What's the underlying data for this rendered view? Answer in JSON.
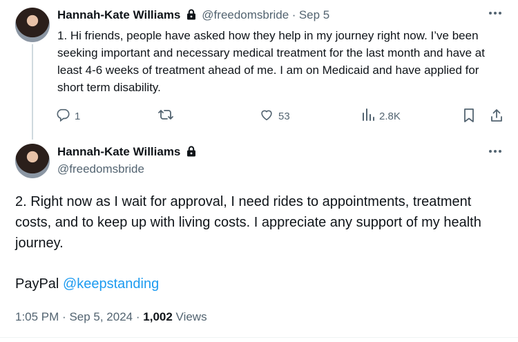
{
  "tweet1": {
    "author_name": "Hannah-Kate Williams",
    "handle": "@freedomsbride",
    "separator": "·",
    "date": "Sep 5",
    "text": "1. Hi friends, people have asked how they help in my journey right now. I’ve been seeking important and necessary medical treatment for the last month and have at least 4-6 weeks of treatment ahead of me. I am on Medicaid and have applied for short term disability.",
    "actions": {
      "replies": "1",
      "reposts": "",
      "likes": "53",
      "views": "2.8K"
    }
  },
  "tweet2": {
    "author_name": "Hannah-Kate Williams",
    "handle": "@freedomsbride",
    "text": "2. Right now as I wait for approval, I need rides to appointments, treatment costs, and to keep up with living costs. I appreciate any support of my health journey.",
    "paypal_label": "PayPal",
    "paypal_link": "@keepstanding",
    "time": "1:05 PM",
    "date": "Sep 5, 2024",
    "views_count": "1,002",
    "views_label": "Views"
  },
  "icons": {
    "more": "more-icon",
    "lock": "lock-icon",
    "reply": "reply-icon",
    "repost": "repost-icon",
    "like": "heart-icon",
    "views": "analytics-icon",
    "bookmark": "bookmark-icon",
    "share": "share-icon"
  },
  "colors": {
    "text": "#0f1419",
    "muted": "#536471",
    "link": "#1d9bf0",
    "thread_line": "#cfd9de"
  }
}
